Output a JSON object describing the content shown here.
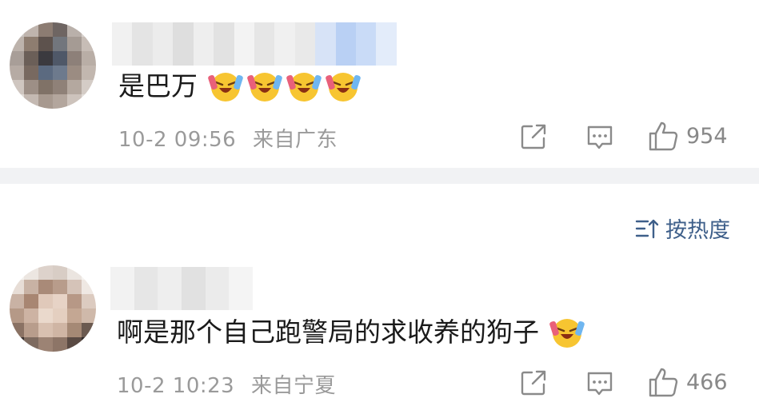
{
  "comments": [
    {
      "text": "是巴万",
      "emoji_count": 4,
      "emoji_name": "laugh-cry-emoji",
      "date": "10-2 09:56",
      "location": "来自广东",
      "likes": "954"
    },
    {
      "text": "啊是那个自己跑警局的求收养的狗子",
      "emoji_count": 1,
      "emoji_name": "laugh-cry-emoji",
      "date": "10-2 10:23",
      "location": "来自宁夏",
      "likes": "466"
    }
  ],
  "sort": {
    "label": "按热度",
    "icon": "sort-icon"
  },
  "icons": {
    "share": "share-icon",
    "reply": "comment-icon",
    "like": "thumb-up-icon"
  },
  "colors": {
    "meta_text": "#9a9a9a",
    "sort_link": "#3e5f8a",
    "divider": "#f1f2f4"
  }
}
